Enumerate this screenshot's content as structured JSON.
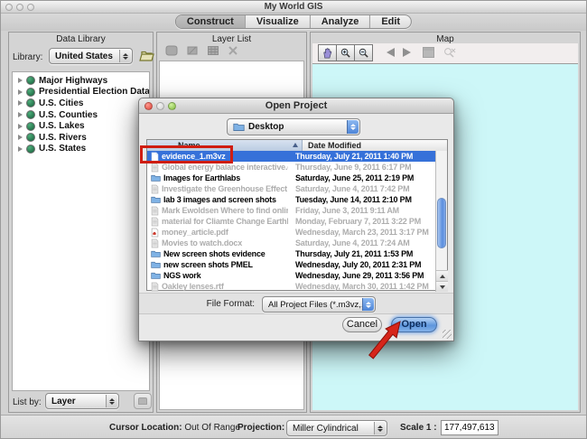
{
  "window": {
    "title": "My World GIS"
  },
  "tabs": [
    {
      "label": "Construct",
      "selected": true
    },
    {
      "label": "Visualize",
      "selected": false
    },
    {
      "label": "Analyze",
      "selected": false
    },
    {
      "label": "Edit",
      "selected": false
    }
  ],
  "data_library": {
    "header": "Data Library",
    "library_label": "Library:",
    "library_value": "United States",
    "items": [
      "Major Highways",
      "Presidential Election Data",
      "U.S. Cities",
      "U.S. Counties",
      "U.S. Lakes",
      "U.S. Rivers",
      "U.S. States"
    ],
    "list_by_label": "List by:",
    "list_by_value": "Layer"
  },
  "layer_list": {
    "header": "Layer List"
  },
  "map": {
    "header": "Map"
  },
  "status_bar": {
    "cursor_label": "Cursor Location:",
    "cursor_value": "Out Of Range",
    "projection_label": "Projection:",
    "projection_value": "Miller Cylindrical",
    "scale_label": "Scale 1 :",
    "scale_value": "177,497,613"
  },
  "dialog": {
    "title": "Open Project",
    "location_value": "Desktop",
    "columns": {
      "name": "Name",
      "date": "Date Modified"
    },
    "files": [
      {
        "name": "evidence_1.m3vz",
        "date": "Thursday, July 21, 2011 1:40 PM",
        "type": "file",
        "selected": true,
        "disabled": false
      },
      {
        "name": "Global energy balance interactive.docx",
        "date": "Thursday, June 9, 2011 6:17 PM",
        "type": "doc",
        "selected": false,
        "disabled": true
      },
      {
        "name": "Images for Earthlabs",
        "date": "Saturday, June 25, 2011 2:19 PM",
        "type": "folder",
        "selected": false,
        "disabled": false
      },
      {
        "name": "Investigate the Greenhouse Effect Jav...",
        "date": "Saturday, June 4, 2011 7:42 PM",
        "type": "doc",
        "selected": false,
        "disabled": true
      },
      {
        "name": "lab 3 images and screen shots",
        "date": "Tuesday, June 14, 2011 2:10 PM",
        "type": "folder",
        "selected": false,
        "disabled": false
      },
      {
        "name": "Mark Ewoldsen Where to find online l...",
        "date": "Friday, June 3, 2011 9:11 AM",
        "type": "doc",
        "selected": false,
        "disabled": true
      },
      {
        "name": "material for Cliamte Change Earthlab...",
        "date": "Monday, February 7, 2011 3:22 PM",
        "type": "doc",
        "selected": false,
        "disabled": true
      },
      {
        "name": "money_article.pdf",
        "date": "Wednesday, March 23, 2011 3:17 PM",
        "type": "pdf",
        "selected": false,
        "disabled": true
      },
      {
        "name": "Movies to watch.docx",
        "date": "Saturday, June 4, 2011 7:24 AM",
        "type": "doc",
        "selected": false,
        "disabled": true
      },
      {
        "name": "New screen shots evidence",
        "date": "Thursday, July 21, 2011 1:53 PM",
        "type": "folder",
        "selected": false,
        "disabled": false
      },
      {
        "name": "new screen shots PMEL",
        "date": "Wednesday, July 20, 2011 2:31 PM",
        "type": "folder",
        "selected": false,
        "disabled": false
      },
      {
        "name": "NGS work",
        "date": "Wednesday, June 29, 2011 3:56 PM",
        "type": "folder",
        "selected": false,
        "disabled": false
      },
      {
        "name": "Oakley lenses.rtf",
        "date": "Wednesday, March 30, 2011 1:42 PM",
        "type": "rtf",
        "selected": false,
        "disabled": true
      }
    ],
    "file_format_label": "File Format:",
    "file_format_value": "All Project Files (*.m3vz,...",
    "cancel_label": "Cancel",
    "open_label": "Open"
  },
  "icons": {
    "toolbar_layer_list": [
      "add-layer-icon",
      "edit-layer-icon",
      "table-icon",
      "delete-icon"
    ],
    "toolbar_map": [
      "pan-hand-icon",
      "zoom-in-icon",
      "zoom-out-icon",
      "back-arrow-icon",
      "forward-arrow-icon",
      "zoom-extent-icon",
      "zoom-selection-icon"
    ]
  },
  "colors": {
    "selection_blue": "#3671d9",
    "map_background": "#cdf7f8",
    "annotation_red": "#cf1d12",
    "open_button_blue": "#5e96dd",
    "name_column_highlight": "#c5d5e8"
  }
}
